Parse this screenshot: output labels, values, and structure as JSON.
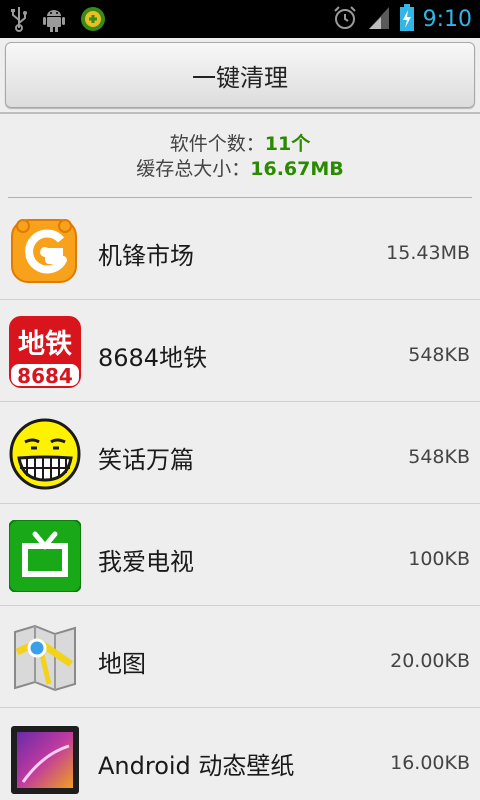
{
  "status_bar": {
    "time": "9:10",
    "left_icons": [
      "usb-icon",
      "android-debug-icon",
      "app-notification-icon"
    ],
    "right_icons": [
      "alarm-icon",
      "signal-icon",
      "battery-charging-icon"
    ]
  },
  "clean_button": {
    "label": "一键清理"
  },
  "summary": {
    "software_label": "软件个数：",
    "software_count": "11个",
    "cache_label": "缓存总大小：",
    "cache_total": "16.67MB"
  },
  "apps": [
    {
      "name": "机锋市场",
      "size": "15.43MB",
      "icon": "gfan-market-icon"
    },
    {
      "name": "8684地铁",
      "size": "548KB",
      "icon": "subway-8684-icon",
      "icon_text_top": "地铁",
      "icon_text_bottom": "8684"
    },
    {
      "name": "笑话万篇",
      "size": "548KB",
      "icon": "grin-face-icon"
    },
    {
      "name": "我爱电视",
      "size": "100KB",
      "icon": "tv-icon"
    },
    {
      "name": "地图",
      "size": "20.00KB",
      "icon": "map-icon"
    },
    {
      "name": "Android 动态壁纸",
      "size": "16.00KB",
      "icon": "live-wallpaper-icon"
    }
  ],
  "colors": {
    "accent_time": "#33b5e5",
    "summary_value": "#2a8a00",
    "background": "#eeeeee"
  }
}
